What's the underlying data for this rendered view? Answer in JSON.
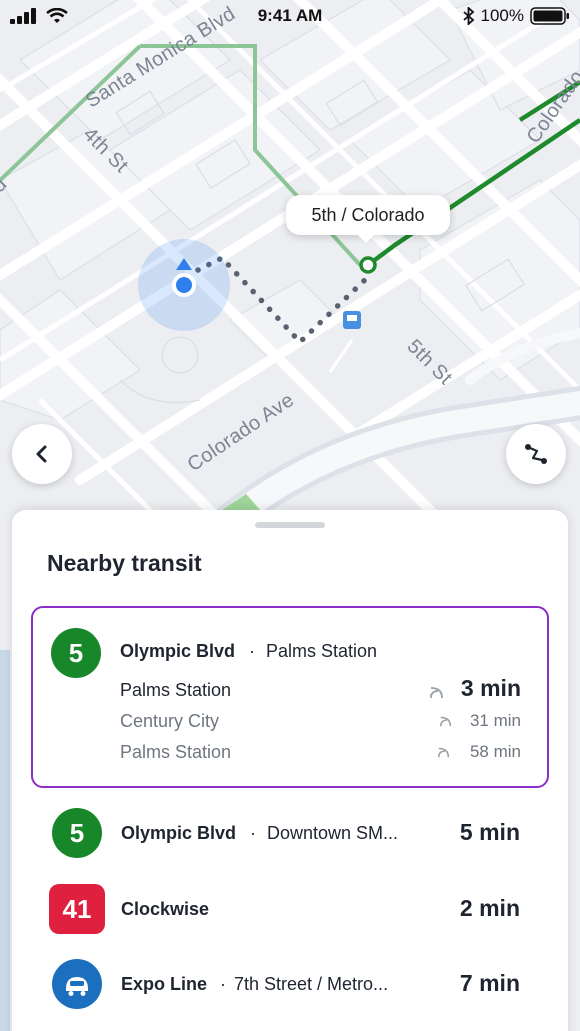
{
  "status_bar": {
    "time": "9:41 AM",
    "battery": "100%"
  },
  "map": {
    "street_labels": {
      "santa_monica": "Santa Monica Blvd",
      "fourth_st": "4th St",
      "fifth_st": "5th St",
      "colorado_ave": "Colorado Ave",
      "colorado_edge": "Colorado",
      "left_edge": "d"
    },
    "callout": "5th / Colorado",
    "colors": {
      "route_green": "#1e8a2c",
      "walk_dots": "#5a6170",
      "user_location": "#2f80ed"
    }
  },
  "sheet": {
    "title": "Nearby transit",
    "selected": {
      "route": "5",
      "line": "Olympic Blvd",
      "separator": "·",
      "destination": "Palms Station",
      "departures": [
        {
          "stop": "Palms Station",
          "minutes": "3 min"
        },
        {
          "stop": "Century City",
          "minutes": "31 min"
        },
        {
          "stop": "Palms Station",
          "minutes": "58 min"
        }
      ]
    },
    "items": [
      {
        "route": "5",
        "line": "Olympic Blvd",
        "separator": "·",
        "destination": "Downtown SM...",
        "minutes": "5 min"
      },
      {
        "route": "41",
        "line": "Clockwise",
        "minutes": "2 min"
      },
      {
        "route_icon": "train-icon",
        "line": "Expo Line",
        "separator": "·",
        "destination": "7th Street / Metro...",
        "minutes": "7 min"
      }
    ],
    "colors": {
      "selected_border": "#8b2fc9",
      "route_5": "#17872a",
      "route_41": "#e0203f",
      "expo": "#1b6fbe"
    }
  }
}
